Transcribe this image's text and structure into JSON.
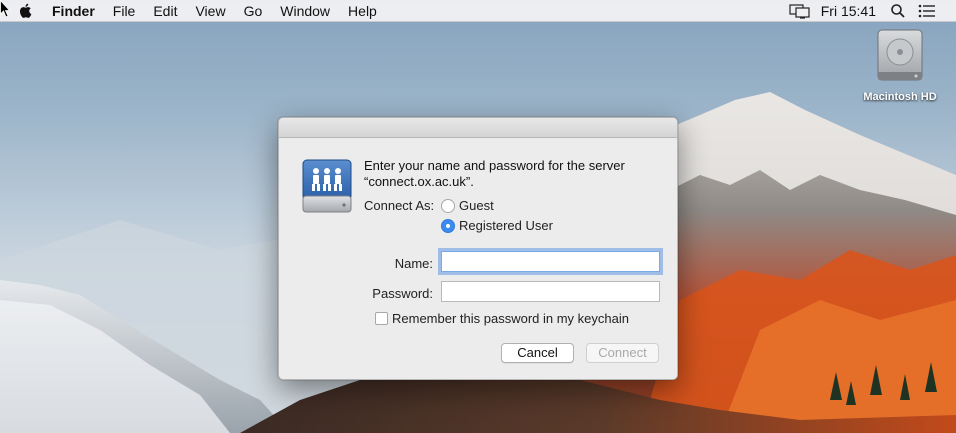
{
  "menubar": {
    "items": [
      {
        "label": "Finder"
      },
      {
        "label": "File"
      },
      {
        "label": "Edit"
      },
      {
        "label": "View"
      },
      {
        "label": "Go"
      },
      {
        "label": "Window"
      },
      {
        "label": "Help"
      }
    ],
    "clock": "Fri 15:41",
    "icons": [
      "apple-icon",
      "display-mirroring-icon",
      "spotlight-search-icon",
      "notification-center-icon"
    ]
  },
  "desktop": {
    "hd_label": "Macintosh HD"
  },
  "dialog": {
    "prompt_line1": "Enter your name and password for the server",
    "prompt_line2": "“connect.ox.ac.uk”.",
    "connect_as_label": "Connect As:",
    "option_guest": "Guest",
    "option_registered": "Registered User",
    "selected_option": "Registered User",
    "name_label": "Name:",
    "name_value": "",
    "password_label": "Password:",
    "password_value": "",
    "remember_label": "Remember this password in my keychain",
    "remember_checked": false,
    "cancel_label": "Cancel",
    "connect_label": "Connect",
    "connect_enabled": false
  },
  "colors": {
    "accent": "#3b8bf0",
    "focus_ring": "#6297e6",
    "disabled_text": "#a9a9a9"
  }
}
